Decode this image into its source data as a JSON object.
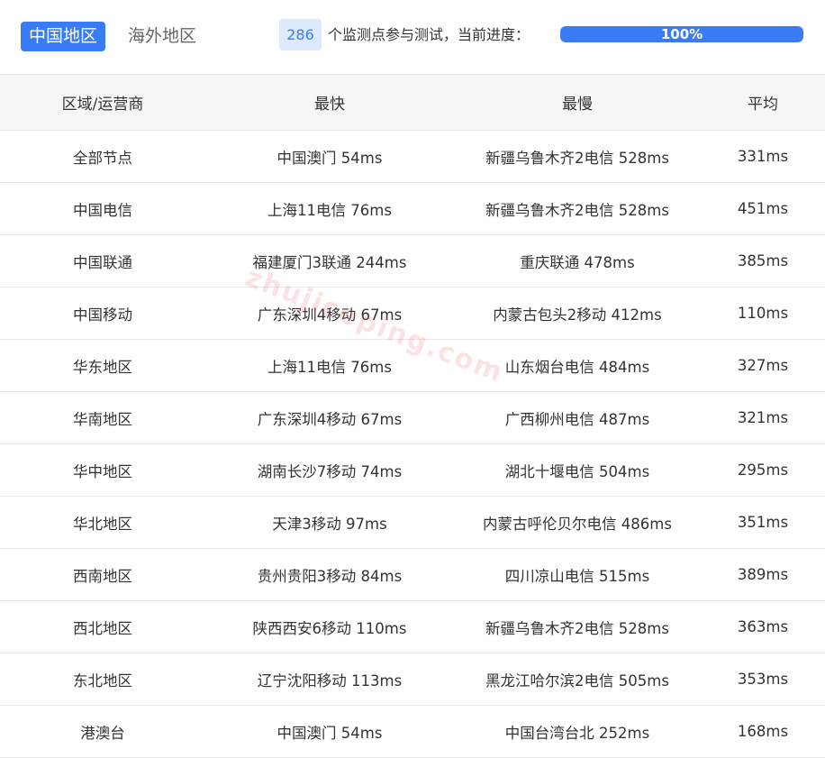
{
  "tabs": [
    {
      "label": "中国地区",
      "active": true
    },
    {
      "label": "海外地区",
      "active": false
    }
  ],
  "monitor": {
    "count": "286",
    "label": "个监测点参与测试，当前进度：",
    "progress": 1.0,
    "progress_text": "100%"
  },
  "table": {
    "headers": [
      "区域/运营商",
      "最快",
      "最慢",
      "平均"
    ],
    "rows": [
      [
        "全部节点",
        "中国澳门 54ms",
        "新疆乌鲁木齐2电信 528ms",
        "331ms"
      ],
      [
        "中国电信",
        "上海11电信 76ms",
        "新疆乌鲁木齐2电信 528ms",
        "451ms"
      ],
      [
        "中国联通",
        "福建厦门3联通 244ms",
        "重庆联通 478ms",
        "385ms"
      ],
      [
        "中国移动",
        "广东深圳4移动 67ms",
        "内蒙古包头2移动 412ms",
        "110ms"
      ],
      [
        "华东地区",
        "上海11电信 76ms",
        "山东烟台电信 484ms",
        "327ms"
      ],
      [
        "华南地区",
        "广东深圳4移动 67ms",
        "广西柳州电信 487ms",
        "321ms"
      ],
      [
        "华中地区",
        "湖南长沙7移动 74ms",
        "湖北十堰电信 504ms",
        "295ms"
      ],
      [
        "华北地区",
        "天津3移动 97ms",
        "内蒙古呼伦贝尔电信 486ms",
        "351ms"
      ],
      [
        "西南地区",
        "贵州贵阳3移动 84ms",
        "四川凉山电信 515ms",
        "389ms"
      ],
      [
        "西北地区",
        "陕西西安6移动 110ms",
        "新疆乌鲁木齐2电信 528ms",
        "363ms"
      ],
      [
        "东北地区",
        "辽宁沈阳移动 113ms",
        "黑龙江哈尔滨2电信 505ms",
        "353ms"
      ],
      [
        "港澳台",
        "中国澳门 54ms",
        "中国台湾台北 252ms",
        "168ms"
      ]
    ]
  },
  "watermark": "zhujiceping.com",
  "colors": {
    "accent": "#3a7cf5",
    "badge_bg": "#dde9fd",
    "header_bg": "#f5f6f8"
  }
}
